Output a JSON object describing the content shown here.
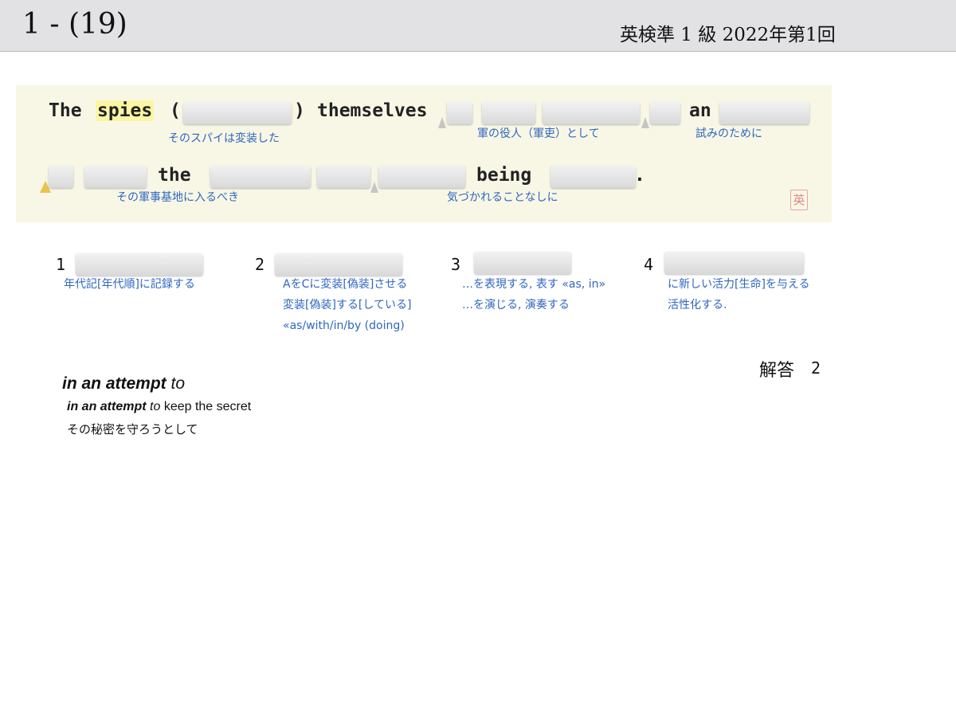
{
  "header": {
    "slide_number": "1 - (19)",
    "exam_label": "英検準 1 級  2022年第1回"
  },
  "sentence": {
    "line1": {
      "the": "The",
      "spies": "spies",
      "open_paren": "(",
      "close_paren": ")",
      "themselves": "themselves",
      "an": "an"
    },
    "line2": {
      "the": "the",
      "being": "being",
      "period": "."
    },
    "glosses": {
      "disguised": "そのスパイは変装した",
      "as_official": "軍の役人（軍吏）として",
      "attempt": "試みのために",
      "enter_base": "その軍事基地に入るべき",
      "unnoticed": "気づかれることなしに"
    },
    "stamp": "英"
  },
  "choices": [
    {
      "number": "1",
      "glosses": [
        "年代記[年代順]に記録する"
      ]
    },
    {
      "number": "2",
      "glosses": [
        "AをCに変装[偽装]させる",
        "変装[偽装]する[している]",
        "«as/with/in/by (doing)"
      ]
    },
    {
      "number": "3",
      "glosses": [
        "…を表現する, 表す «as, in»",
        "…を演じる, 演奏する"
      ]
    },
    {
      "number": "4",
      "glosses": [
        "に新しい活力[生命]を与える",
        "活性化する."
      ]
    }
  ],
  "answer": {
    "label": "解答",
    "value": "2"
  },
  "phrase": {
    "bold_part": "in an attempt",
    "italic_part": "to",
    "example_bold": "in an attempt",
    "example_italic": "to",
    "example_rest": "keep the secret",
    "translation": "その秘密を守ろうとして"
  },
  "colors": {
    "header_bg": "#e2e2e4",
    "sentence_bg": "#f8f7e6",
    "gloss_blue": "#2f66c0",
    "highlight": "#fbf6a4"
  }
}
